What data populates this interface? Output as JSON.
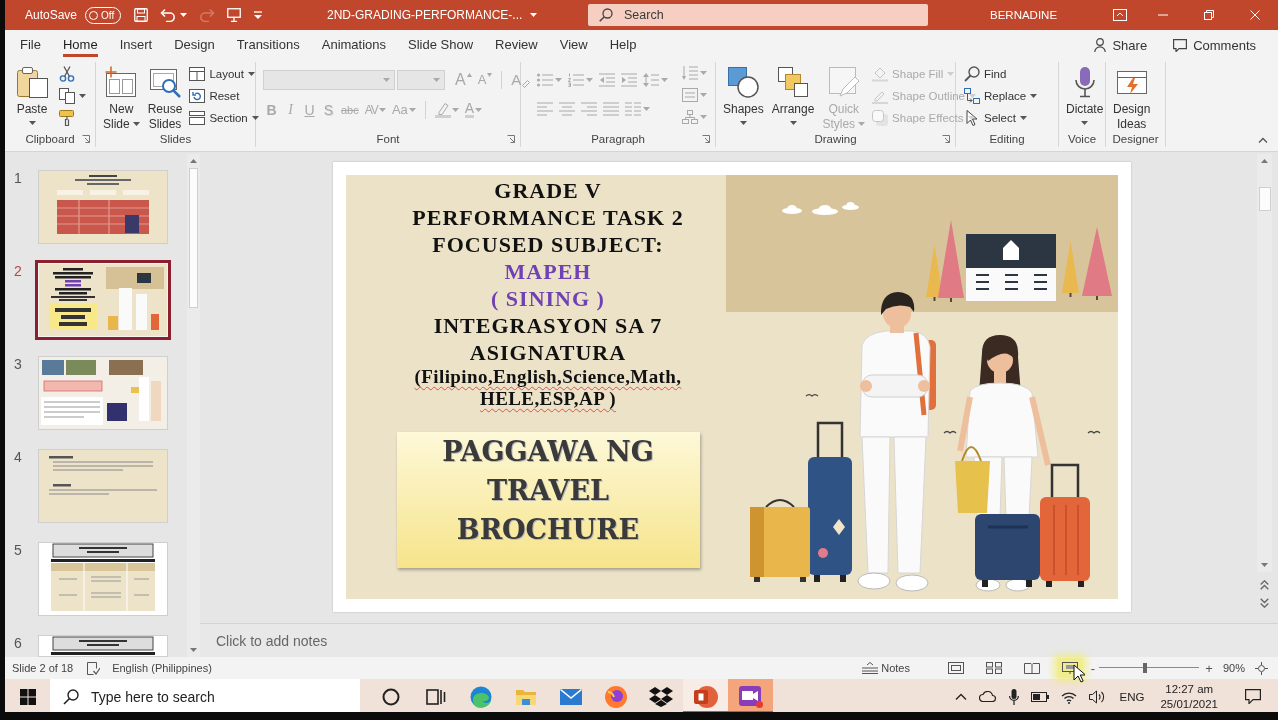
{
  "title_bar": {
    "autosave_label": "AutoSave",
    "autosave_toggle": {
      "label": "Off",
      "on": false
    },
    "quick_access": [
      {
        "kind": "save",
        "disabled": false,
        "dropdown": false
      },
      {
        "kind": "undo",
        "disabled": false,
        "dropdown": true
      },
      {
        "kind": "redo",
        "disabled": true,
        "dropdown": false
      },
      {
        "kind": "present",
        "disabled": false,
        "dropdown": false
      },
      {
        "kind": "customize",
        "disabled": false,
        "dropdown": false
      }
    ],
    "document_title": "2ND-GRADING-PERFORMANCE-...",
    "search": {
      "placeholder": "Search"
    },
    "account_name": "BERNADINE"
  },
  "ribbon_tabs": [
    {
      "label": "File",
      "selected": false
    },
    {
      "label": "Home",
      "selected": true
    },
    {
      "label": "Insert",
      "selected": false
    },
    {
      "label": "Design",
      "selected": false
    },
    {
      "label": "Transitions",
      "selected": false
    },
    {
      "label": "Animations",
      "selected": false
    },
    {
      "label": "Slide Show",
      "selected": false
    },
    {
      "label": "Review",
      "selected": false
    },
    {
      "label": "View",
      "selected": false
    },
    {
      "label": "Help",
      "selected": false
    }
  ],
  "ribbon_actions": {
    "share": "Share",
    "comments": "Comments"
  },
  "ribbon_groups": [
    {
      "kind": "clipboard",
      "label": "Clipboard",
      "launcher": true,
      "large": [
        {
          "kind": "paste",
          "label": "Paste",
          "dropdown": true,
          "disabled": false
        }
      ],
      "small": [
        {
          "kind": "cut",
          "dropdown": false,
          "disabled": false
        },
        {
          "kind": "copy",
          "dropdown": true,
          "disabled": false
        },
        {
          "kind": "format_painter",
          "dropdown": false,
          "disabled": false
        }
      ]
    },
    {
      "kind": "slides",
      "label": "Slides",
      "launcher": false,
      "large": [
        {
          "kind": "new_slide",
          "label": "New Slide",
          "dropdown": true,
          "disabled": false
        },
        {
          "kind": "reuse_slides",
          "label": "Reuse Slides",
          "dropdown": false,
          "disabled": false
        }
      ],
      "small": [
        {
          "kind": "layout",
          "label": "Layout",
          "dropdown": true,
          "disabled": false
        },
        {
          "kind": "reset",
          "label": "Reset",
          "dropdown": false,
          "disabled": false
        },
        {
          "kind": "section",
          "label": "Section",
          "dropdown": true,
          "disabled": false
        }
      ]
    },
    {
      "kind": "font",
      "label": "Font",
      "launcher": true,
      "disabled": true,
      "row1": [
        {
          "kind": "grow",
          "glyph": "A",
          "dropdown": false
        },
        {
          "kind": "shrink",
          "glyph": "A",
          "dropdown": false
        },
        {
          "kind": "clear",
          "glyph": "A",
          "dropdown": false
        }
      ],
      "row2": [
        {
          "kind": "bold",
          "glyph": "B",
          "dropdown": false
        },
        {
          "kind": "italic",
          "glyph": "I",
          "dropdown": false
        },
        {
          "kind": "underline",
          "glyph": "U",
          "dropdown": false
        },
        {
          "kind": "shadow",
          "glyph": "S",
          "dropdown": false
        },
        {
          "kind": "strike",
          "glyph": "abc",
          "dropdown": false
        },
        {
          "kind": "spacing",
          "glyph": "AV",
          "dropdown": true
        },
        {
          "kind": "case",
          "glyph": "Aa",
          "dropdown": true
        },
        {
          "kind": "highlight",
          "dropdown": true
        },
        {
          "kind": "color",
          "glyph": "A",
          "dropdown": true
        }
      ]
    },
    {
      "kind": "paragraph",
      "label": "Paragraph",
      "launcher": true,
      "disabled": true,
      "row1": [
        {
          "kind": "bullets",
          "dropdown": true
        },
        {
          "kind": "numbering",
          "dropdown": true
        },
        {
          "kind": "outdent",
          "dropdown": false
        },
        {
          "kind": "indent",
          "dropdown": false
        },
        {
          "kind": "line_spacing",
          "dropdown": true
        }
      ],
      "row2": [
        {
          "kind": "align_left",
          "dropdown": false
        },
        {
          "kind": "align_center",
          "dropdown": false
        },
        {
          "kind": "align_right",
          "dropdown": false
        },
        {
          "kind": "justify",
          "dropdown": false
        },
        {
          "kind": "columns",
          "dropdown": true
        }
      ],
      "column": [
        {
          "kind": "text_direction",
          "dropdown": true
        },
        {
          "kind": "align_text",
          "dropdown": true
        },
        {
          "kind": "smartart",
          "dropdown": true
        }
      ]
    },
    {
      "kind": "drawing",
      "label": "Drawing",
      "launcher": true,
      "large": [
        {
          "kind": "shapes",
          "label": "Shapes",
          "dropdown": true,
          "disabled": false
        },
        {
          "kind": "arrange",
          "label": "Arrange",
          "dropdown": true,
          "disabled": false
        },
        {
          "kind": "quick_styles",
          "label": "Quick Styles",
          "dropdown": true,
          "disabled": true
        }
      ],
      "small": [
        {
          "kind": "shape_fill",
          "label": "Shape Fill",
          "dropdown": true,
          "disabled": true
        },
        {
          "kind": "shape_outline",
          "label": "Shape Outline",
          "dropdown": true,
          "disabled": true
        },
        {
          "kind": "shape_effects",
          "label": "Shape Effects",
          "dropdown": true,
          "disabled": true
        }
      ]
    },
    {
      "kind": "editing",
      "label": "Editing",
      "launcher": false,
      "small": [
        {
          "kind": "find",
          "label": "Find",
          "dropdown": false,
          "disabled": false
        },
        {
          "kind": "replace",
          "label": "Replace",
          "dropdown": true,
          "disabled": false
        },
        {
          "kind": "select",
          "label": "Select",
          "dropdown": true,
          "disabled": false
        }
      ]
    },
    {
      "kind": "voice",
      "label": "Voice",
      "launcher": false,
      "large": [
        {
          "kind": "dictate",
          "label": "Dictate",
          "dropdown": true,
          "disabled": false
        }
      ]
    },
    {
      "kind": "designer",
      "label": "Designer",
      "launcher": false,
      "large": [
        {
          "kind": "design_ideas",
          "label": "Design Ideas",
          "dropdown": false,
          "disabled": false
        }
      ]
    }
  ],
  "slide_thumbnails": [
    {
      "number": "1",
      "kind": "cover",
      "selected": false
    },
    {
      "number": "2",
      "kind": "title",
      "selected": true
    },
    {
      "number": "3",
      "kind": "gallery",
      "selected": false
    },
    {
      "number": "4",
      "kind": "text",
      "selected": false
    },
    {
      "number": "5",
      "kind": "table",
      "selected": false
    },
    {
      "number": "6",
      "kind": "table",
      "selected": false
    }
  ],
  "slide": {
    "heading_lines": [
      {
        "text": "GRADE V",
        "kind": "heading",
        "spelling_flag": false
      },
      {
        "text": "PERFORMANCE TASK 2",
        "kind": "heading",
        "spelling_flag": false
      },
      {
        "text": "FOCUSED SUBJECT:",
        "kind": "heading",
        "spelling_flag": false
      },
      {
        "text": "MAPEH",
        "kind": "subject",
        "spelling_flag": false
      },
      {
        "text": "( SINING )",
        "kind": "subject",
        "spelling_flag": false
      },
      {
        "text": "INTEGRASYON SA 7",
        "kind": "heading",
        "spelling_flag": false
      },
      {
        "text": "ASIGNATURA",
        "kind": "heading",
        "spelling_flag": false
      },
      {
        "text": "(Filipino,English,Science,Math,",
        "kind": "list",
        "spelling_flag": true
      },
      {
        "text": "HELE,ESP,AP )",
        "kind": "list",
        "spelling_flag": true
      }
    ],
    "title_box_lines": [
      "PAGGAWA NG",
      "TRAVEL",
      "BROCHURE"
    ]
  },
  "notes": {
    "placeholder": "Click to add notes"
  },
  "status_bar": {
    "slide_counter": "Slide 2 of 18",
    "language": "English (Philippines)",
    "notes_button": "Notes",
    "views": [
      {
        "kind": "normal",
        "hovered": false
      },
      {
        "kind": "sorter",
        "hovered": false
      },
      {
        "kind": "reading",
        "hovered": false
      },
      {
        "kind": "slideshow",
        "hovered": true
      }
    ],
    "zoom": {
      "zoom_out": "-",
      "zoom_in": "+",
      "level": 0.46,
      "reading": "90%"
    }
  },
  "taskbar": {
    "search": {
      "placeholder": "Type here to search"
    },
    "apps": [
      {
        "kind": "cortana",
        "running": false,
        "active": false
      },
      {
        "kind": "task_view",
        "running": false,
        "active": false
      },
      {
        "kind": "edge",
        "running": false,
        "active": false
      },
      {
        "kind": "explorer",
        "running": false,
        "active": false
      },
      {
        "kind": "mail",
        "running": false,
        "active": false
      },
      {
        "kind": "firefox",
        "running": false,
        "active": false
      },
      {
        "kind": "dropbox",
        "running": false,
        "active": false
      },
      {
        "kind": "powerpoint",
        "running": true,
        "active": false
      },
      {
        "kind": "recorder",
        "running": true,
        "active": true
      }
    ],
    "tray": {
      "language": "ENG",
      "time": "12:27 am",
      "date": "25/01/2021"
    }
  }
}
